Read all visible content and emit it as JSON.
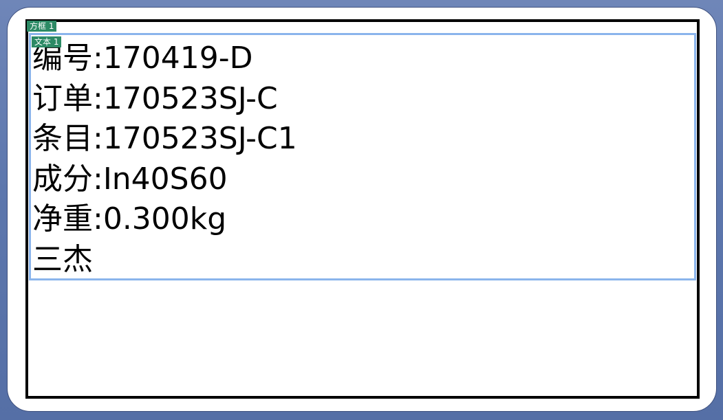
{
  "frame_tag": "方框 1",
  "text_tag": "文本 1",
  "label": {
    "lines": [
      "编号:170419-D",
      "订单:170523SJ-C",
      "条目:170523SJ-C1",
      "成分:In40S60",
      "净重:0.300kg",
      "三杰"
    ]
  },
  "colors": {
    "background": "#5d77ad",
    "frame_border": "#000000",
    "text_box_border": "#8ab4ec",
    "tag_bg": "#2c8a65"
  }
}
